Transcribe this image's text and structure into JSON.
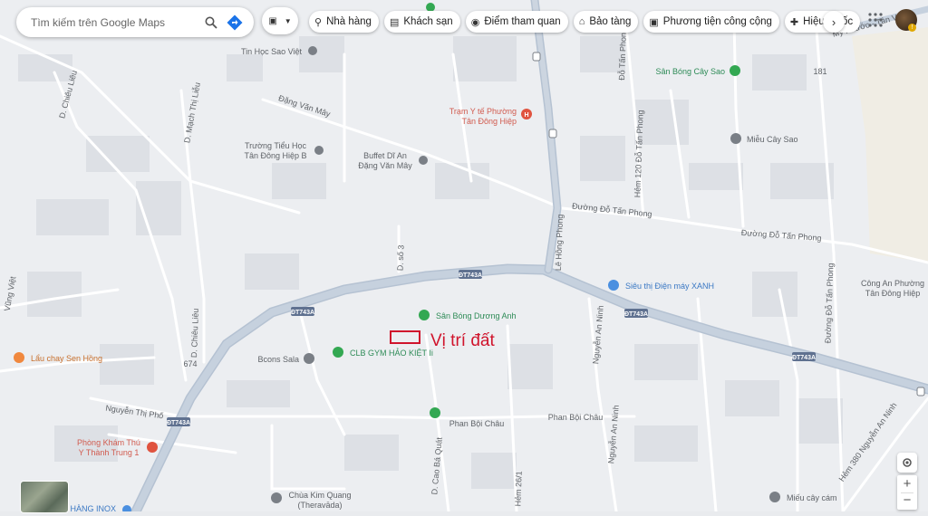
{
  "search": {
    "placeholder": "Tìm kiếm trên Google Maps"
  },
  "chips": [
    {
      "label": "Nhà hàng",
      "icon": "fork-knife-icon"
    },
    {
      "label": "Khách sạn",
      "icon": "bed-icon"
    },
    {
      "label": "Điểm tham quan",
      "icon": "camera-icon"
    },
    {
      "label": "Bảo tàng",
      "icon": "museum-icon"
    },
    {
      "label": "Phương tiện công cộng",
      "icon": "bus-icon"
    },
    {
      "label": "Hiệu thuốc",
      "icon": "pharmacy-icon"
    }
  ],
  "colors": {
    "map_bg": "#eceef1",
    "street": "#ffffff",
    "main_road": "#c6d1de",
    "building": "#dde0e5",
    "label_text": "#5f6368",
    "poi_green": "#33a852",
    "poi_gray": "#7a7f86",
    "poi_red": "#e0533f",
    "poi_blue": "#4a8fe0",
    "marker_red": "#d0142c"
  },
  "marker": {
    "label": "Vị trí đất"
  },
  "streets": [
    "Đặng Văn Mây",
    "Đường Đỗ Tấn Phong",
    "Đường Đỗ Tấn Phong",
    "Lê Hồng Phong",
    "Hẻm 120 Đỗ Tấn Phong",
    "Đỗ Tấn Phong",
    "D. Chiêu Liêu",
    "D. Mạch Thị Liễu",
    "D. Chiêu Liêu",
    "Nguyễn An Ninh",
    "Nguyễn An Ninh",
    "Phan Bội Châu",
    "Phan Bội Châu",
    "Nguyễn Thị Phố",
    "D. Cao Bá Quát",
    "D. số 3",
    "Hẻm 26/1",
    "Hẻm 380 Nguyễn An Ninh",
    "Đường Đỗ Tấn Phong",
    "ĐT743A",
    "ĐT743A",
    "ĐT743A",
    "ĐT743A",
    "ĐT743A",
    "674",
    "Vũng Việt",
    "Mỹ Phước - Tân Vạn",
    "181"
  ],
  "places": [
    {
      "name": "Tin Học Sao Việt",
      "type": "gray"
    },
    {
      "name": "Trạm Y tế Phường Tân Đông Hiệp",
      "type": "red"
    },
    {
      "name": "Sân Bóng Cây Sao",
      "type": "green"
    },
    {
      "name": "Miễu Cây Sao",
      "type": "gray"
    },
    {
      "name": "Trường Tiểu Học Tân Đông Hiệp B",
      "type": "gray"
    },
    {
      "name": "Buffet Dĩ An Đặng Văn Mây",
      "type": "gray"
    },
    {
      "name": "Siêu thị Điện máy XANH",
      "type": "blue"
    },
    {
      "name": "Công An Phường Tân Đông Hiệp",
      "type": "gray"
    },
    {
      "name": "Sân Bóng Dương Anh",
      "type": "green"
    },
    {
      "name": "CLB GYM HẢO KIỆT Ii",
      "type": "green"
    },
    {
      "name": "Bcons Sala",
      "type": "gray"
    },
    {
      "name": "Lẩu chay Sen Hồng",
      "type": "orange"
    },
    {
      "name": "Phòng Khám Thú Y Thành Trung 1",
      "type": "red"
    },
    {
      "name": "Chùa Kim Quang (Theravāda)",
      "type": "gray"
    },
    {
      "name": "Miếu cây cám",
      "type": "gray"
    },
    {
      "name": "HÀNG INOX",
      "type": "blue"
    }
  ]
}
